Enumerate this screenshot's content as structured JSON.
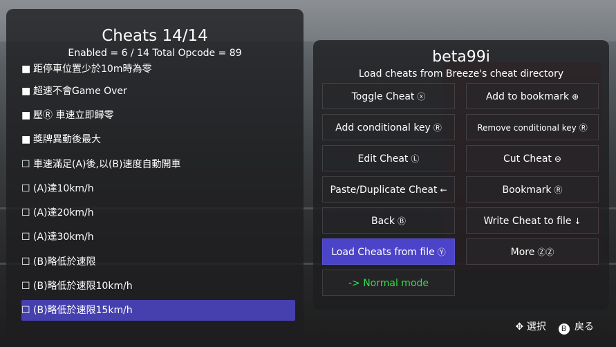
{
  "cheats_panel": {
    "title": "Cheats  14/14",
    "summary": "Enabled = 6 / 14  Total Opcode = 89",
    "items": [
      {
        "label": "距停車位置少於10m時為零",
        "enabled": true
      },
      {
        "label": "超速不會Game Over",
        "enabled": true
      },
      {
        "label": "壓Ⓡ 車速立即歸零",
        "enabled": true
      },
      {
        "label": "獎牌異動後最大",
        "enabled": true
      },
      {
        "label": "車速滿足(A)後,以(B)速度自動開車",
        "enabled": false
      },
      {
        "label": "(A)達10km/h",
        "enabled": false
      },
      {
        "label": "(A)達20km/h",
        "enabled": false
      },
      {
        "label": "(A)達30km/h",
        "enabled": false
      },
      {
        "label": "(B)略低於速限",
        "enabled": false
      },
      {
        "label": "(B)略低於速限10km/h",
        "enabled": false
      },
      {
        "label": "(B)略低於速限15km/h",
        "enabled": false,
        "selected": true
      }
    ]
  },
  "menu_panel": {
    "title": "beta99i",
    "subtitle": "Load cheats from Breeze's cheat directory",
    "buttons": [
      {
        "label": "Toggle Cheat",
        "icon": "ⓧ"
      },
      {
        "label": "Add to bookmark",
        "icon": "⊕"
      },
      {
        "label": "Add conditional key",
        "icon": "Ⓡ"
      },
      {
        "label": "Remove conditional key",
        "icon": "Ⓡ"
      },
      {
        "label": "Edit Cheat",
        "icon": "Ⓛ"
      },
      {
        "label": "Cut Cheat",
        "icon": "⊖"
      },
      {
        "label": "Paste/Duplicate Cheat",
        "icon": "←"
      },
      {
        "label": "Bookmark",
        "icon": "Ⓡ"
      },
      {
        "label": "Back",
        "icon": "Ⓑ"
      },
      {
        "label": "Write Cheat to file",
        "icon": "↓"
      },
      {
        "label": "Load Cheats from file",
        "icon": "Ⓨ"
      },
      {
        "label": "More",
        "icon": "ⓏⓏ"
      },
      {
        "label": "-> Normal mode",
        "icon": ""
      }
    ]
  },
  "footer": {
    "select_label": "選択",
    "back_key": "B",
    "back_label": "戻る"
  },
  "colors": {
    "selected": "#4c44c8",
    "normal_mode": "#2ee04a"
  }
}
